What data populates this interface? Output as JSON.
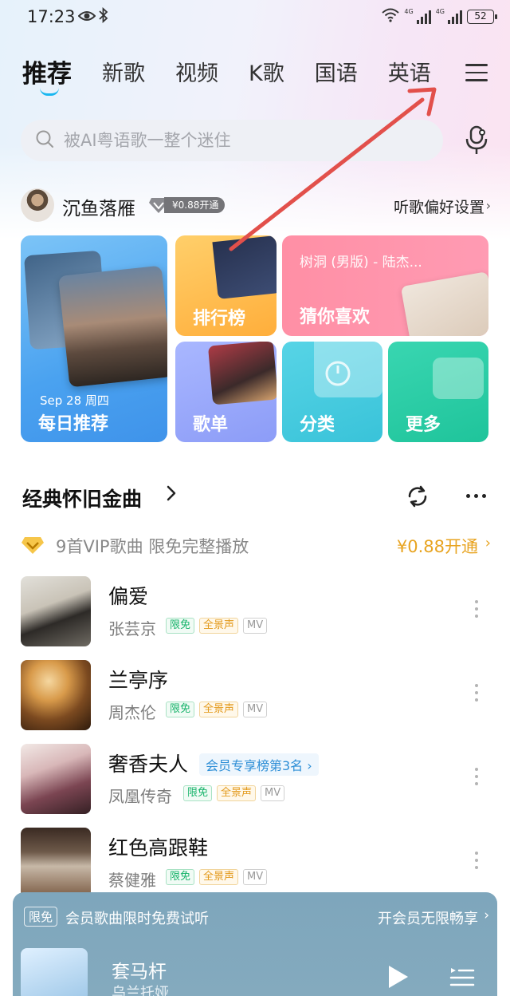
{
  "status_bar": {
    "time": "17:23",
    "battery": "52",
    "network": "4G"
  },
  "tabs": [
    {
      "label": "推荐"
    },
    {
      "label": "新歌"
    },
    {
      "label": "视频"
    },
    {
      "label": "K歌"
    },
    {
      "label": "国语"
    },
    {
      "label": "英语"
    }
  ],
  "search": {
    "placeholder": "被AI粤语歌一整个迷住"
  },
  "user": {
    "name": "沉鱼落雁",
    "vip_offer": "¥0.88开通",
    "preference_link": "听歌偏好设置"
  },
  "cards": {
    "daily": {
      "date": "Sep 28 周四",
      "title": "每日推荐"
    },
    "rank": {
      "title": "排行榜"
    },
    "guess": {
      "song": "树洞 (男版) - 陆杰...",
      "title": "猜你喜欢"
    },
    "playlist": {
      "title": "歌单"
    },
    "category": {
      "title": "分类"
    },
    "more": {
      "title": "更多"
    }
  },
  "section": {
    "title": "经典怀旧金曲",
    "vip_note": "9首VIP歌曲 限免完整播放",
    "vip_link": "¥0.88开通"
  },
  "songs": [
    {
      "title": "偏爱",
      "artist": "张芸京",
      "tags": [
        "限免",
        "全景声",
        "MV"
      ]
    },
    {
      "title": "兰亭序",
      "artist": "周杰伦",
      "tags": [
        "限免",
        "全景声",
        "MV"
      ]
    },
    {
      "title": "奢香夫人",
      "artist": "凤凰传奇",
      "rank_tag": "会员专享榜第3名",
      "tags": [
        "限免",
        "全景声",
        "MV"
      ]
    },
    {
      "title": "红色高跟鞋",
      "artist": "蔡健雅",
      "tags": [
        "限免",
        "全景声",
        "MV"
      ]
    }
  ],
  "player": {
    "promo_tag": "限免",
    "promo_text": "会员歌曲限时免费试听",
    "promo_link": "开会员无限畅享",
    "now_title": "套马杆",
    "now_artist": "乌兰托娅"
  },
  "colors": {
    "accent": "#18b7f0",
    "vip_gold": "#e8a421",
    "free_tag": "#17b36a",
    "annotation_arrow": "#e2504b"
  }
}
